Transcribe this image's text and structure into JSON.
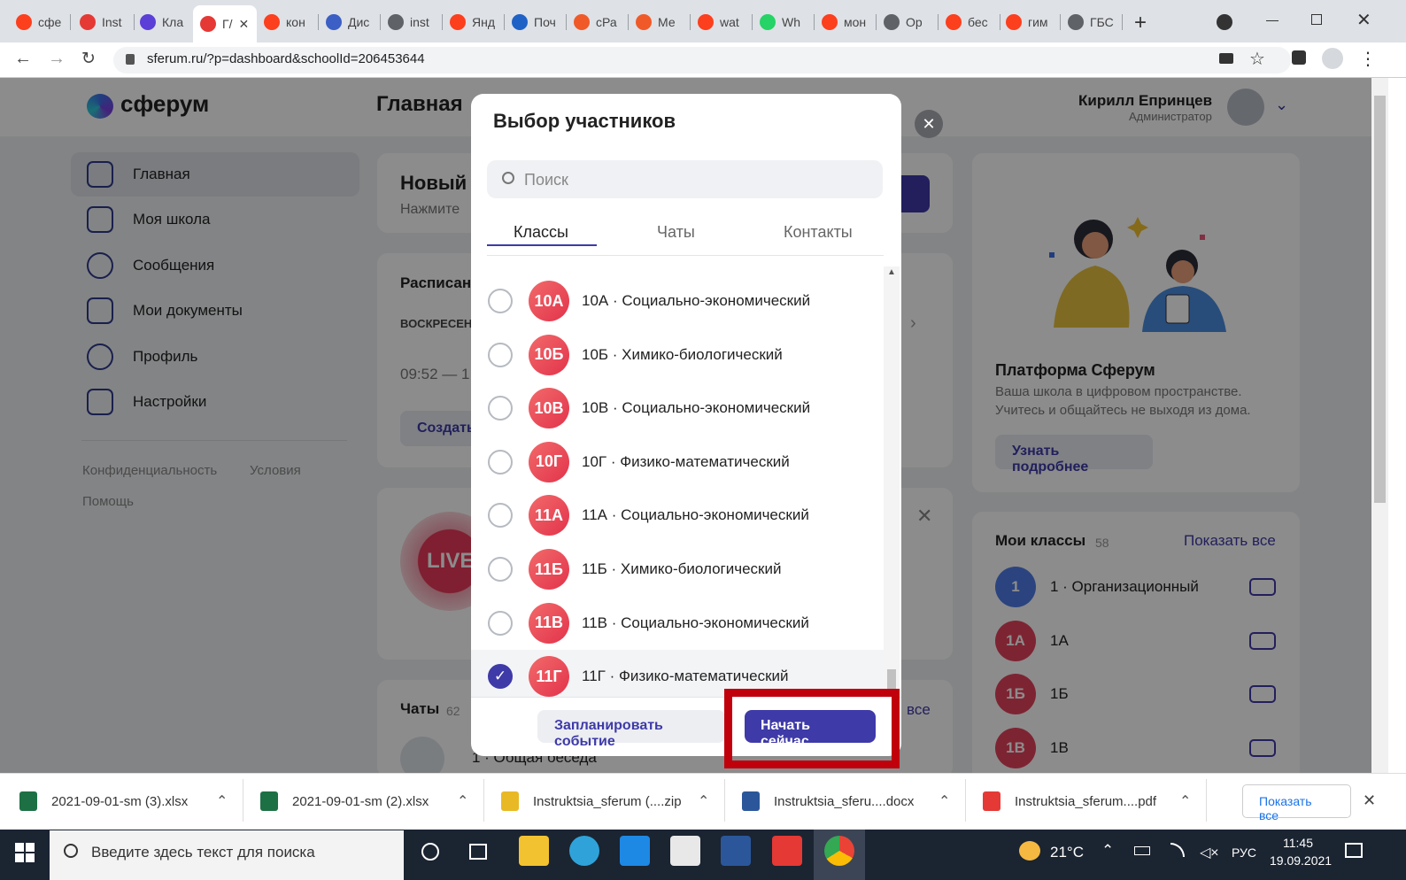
{
  "browser": {
    "tabs": [
      {
        "title": "сфе",
        "icon": "yandex-icon",
        "color": "#fc3f1d"
      },
      {
        "title": "Inst",
        "icon": "pdf-icon",
        "color": "#e53935"
      },
      {
        "title": "Кла",
        "icon": "sferum-icon",
        "color": "#5b3fd6"
      },
      {
        "title": "Г/",
        "icon": "recording-icon",
        "color": "#e53935",
        "active": true
      },
      {
        "title": "кон",
        "icon": "yandex-icon",
        "color": "#fc3f1d"
      },
      {
        "title": "Дис",
        "icon": "dis-icon",
        "color": "#3b5fc4"
      },
      {
        "title": "inst",
        "icon": "globe-icon",
        "color": "#5f6368"
      },
      {
        "title": "Янд",
        "icon": "yandex-icon",
        "color": "#fc3f1d"
      },
      {
        "title": "Поч",
        "icon": "mail-icon",
        "color": "#1e62c6"
      },
      {
        "title": "сРа",
        "icon": "cp-icon",
        "color": "#f05a28"
      },
      {
        "title": "Ме",
        "icon": "cp-icon",
        "color": "#f05a28"
      },
      {
        "title": "wat",
        "icon": "yandex-icon",
        "color": "#fc3f1d"
      },
      {
        "title": "Wh",
        "icon": "whatsapp-icon",
        "color": "#25d366"
      },
      {
        "title": "мон",
        "icon": "yandex-icon",
        "color": "#fc3f1d"
      },
      {
        "title": "Ор",
        "icon": "globe-icon",
        "color": "#5f6368"
      },
      {
        "title": "бес",
        "icon": "yandex-icon",
        "color": "#fc3f1d"
      },
      {
        "title": "гим",
        "icon": "yandex-icon",
        "color": "#fc3f1d"
      },
      {
        "title": "ГБС",
        "icon": "globe-icon",
        "color": "#5f6368"
      }
    ],
    "new_tab": "+",
    "url": "sferum.ru/?p=dashboard&schoolId=206453644"
  },
  "app": {
    "logo": "сферум",
    "page_title": "Главная",
    "user_name": "Кирилл Епринцев",
    "user_role": "Администратор"
  },
  "sidebar": {
    "items": [
      "Главная",
      "Моя школа",
      "Сообщения",
      "Мои документы",
      "Профиль",
      "Настройки"
    ],
    "footer": {
      "privacy": "Конфиденциальность",
      "terms": "Условия",
      "help": "Помощь"
    }
  },
  "main": {
    "new_card_title": "Новый",
    "new_card_sub": "Нажмите",
    "schedule_title": "Расписан",
    "schedule_day": "ВОСКРЕСЕН",
    "schedule_time": "09:52 — 1",
    "create_button": "Создать",
    "live_label": "LIVE",
    "chats_title": "Чаты",
    "chats_count": "62",
    "chat_item": "1 · Общая беседа",
    "chats_all": "все"
  },
  "right": {
    "platform_title": "Платформа Сферум",
    "platform_text1": "Ваша школа в цифровом пространстве.",
    "platform_text2": "Учитесь и общайтесь не выходя из дома.",
    "learn_more": "Узнать подробнее",
    "my_classes": "Мои классы",
    "my_classes_count": "58",
    "show_all": "Показать все",
    "classes": [
      {
        "badge": "1",
        "name": "1 · Организационный"
      },
      {
        "badge": "1А",
        "name": "1А"
      },
      {
        "badge": "1Б",
        "name": "1Б"
      },
      {
        "badge": "1В",
        "name": "1В"
      }
    ]
  },
  "modal": {
    "title": "Выбор участников",
    "search_placeholder": "Поиск",
    "tabs": [
      "Классы",
      "Чаты",
      "Контакты"
    ],
    "active_tab": "Классы",
    "items": [
      {
        "badge": "10А",
        "label": "10А · Социально-экономический",
        "checked": false
      },
      {
        "badge": "10Б",
        "label": "10Б · Химико-биологический",
        "checked": false
      },
      {
        "badge": "10В",
        "label": "10В · Социально-экономический",
        "checked": false
      },
      {
        "badge": "10Г",
        "label": "10Г · Физико-математический",
        "checked": false
      },
      {
        "badge": "11А",
        "label": "11А · Социально-экономический",
        "checked": false
      },
      {
        "badge": "11Б",
        "label": "11Б · Химико-биологический",
        "checked": false
      },
      {
        "badge": "11В",
        "label": "11В · Социально-экономический",
        "checked": false
      },
      {
        "badge": "11Г",
        "label": "11Г · Физико-математический",
        "checked": true
      }
    ],
    "schedule_button": "Запланировать событие",
    "start_button": "Начать сейчас",
    "highlight_color": "#c0000b"
  },
  "downloads": {
    "items": [
      {
        "name": "2021-09-01-sm (3).xlsx",
        "icon": "excel-icon",
        "color": "#1d7044"
      },
      {
        "name": "2021-09-01-sm (2).xlsx",
        "icon": "excel-icon",
        "color": "#1d7044"
      },
      {
        "name": "Instruktsia_sferum (....zip",
        "icon": "zip-icon",
        "color": "#e8b925"
      },
      {
        "name": "Instruktsia_sferu....docx",
        "icon": "word-icon",
        "color": "#2b579a"
      },
      {
        "name": "Instruktsia_sferum....pdf",
        "icon": "pdf-icon",
        "color": "#e53935"
      }
    ],
    "show_all": "Показать все"
  },
  "taskbar": {
    "search_placeholder": "Введите здесь текст для поиска",
    "weather": "21°C",
    "lang": "РУС",
    "time": "11:45",
    "date": "19.09.2021"
  }
}
